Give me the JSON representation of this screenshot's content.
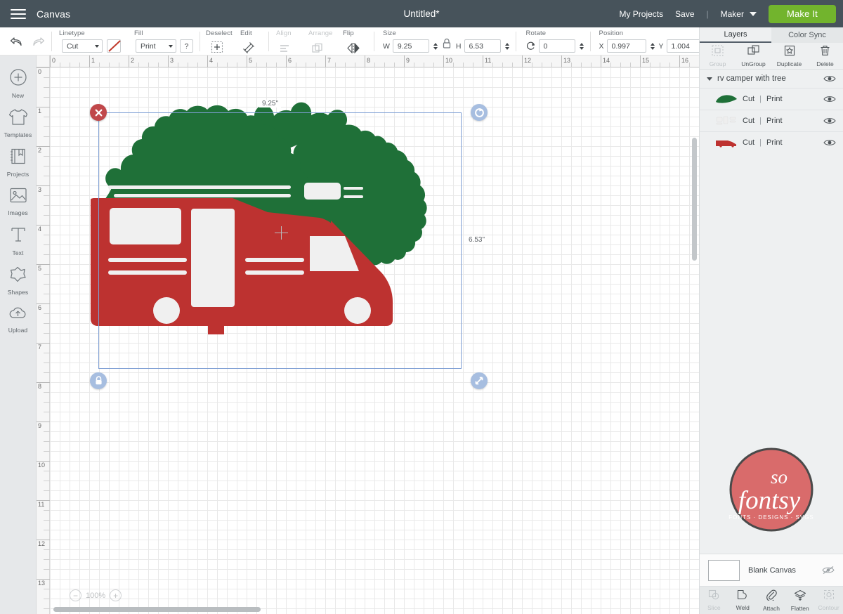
{
  "header": {
    "menu_icon": "hamburger-icon",
    "canvas_label": "Canvas",
    "document_title": "Untitled*",
    "my_projects": "My Projects",
    "save": "Save",
    "separator": "|",
    "machine": "Maker",
    "make_it": "Make It",
    "accent_green": "#72b42d",
    "header_bg": "#47535b"
  },
  "toolbar": {
    "undo_icon": "undo-arrow-icon",
    "redo_icon": "redo-arrow-icon",
    "linetype_label": "Linetype",
    "linetype_value": "Cut",
    "linetype_color_swatch": "#c0392b",
    "fill_label": "Fill",
    "fill_value": "Print",
    "fill_help": "?",
    "deselect_label": "Deselect",
    "edit_label": "Edit",
    "align_label": "Align",
    "arrange_label": "Arrange",
    "flip_label": "Flip",
    "size_label": "Size",
    "width_prefix": "W",
    "width_value": "9.25",
    "lock_icon": "lock-aspect-icon",
    "height_prefix": "H",
    "height_value": "6.53",
    "rotate_label": "Rotate",
    "rotate_value": "0",
    "position_label": "Position",
    "x_prefix": "X",
    "x_value": "0.997",
    "y_prefix": "Y",
    "y_value": "1.004",
    "highlight_color": "#e4515c"
  },
  "sidebar": {
    "items": [
      {
        "label": "New",
        "icon": "plus-circle-icon"
      },
      {
        "label": "Templates",
        "icon": "tshirt-icon"
      },
      {
        "label": "Projects",
        "icon": "book-icon"
      },
      {
        "label": "Images",
        "icon": "picture-icon"
      },
      {
        "label": "Text",
        "icon": "text-t-icon"
      },
      {
        "label": "Shapes",
        "icon": "shapes-icon"
      },
      {
        "label": "Upload",
        "icon": "cloud-upload-icon"
      }
    ]
  },
  "canvas": {
    "ruler_h_labels": [
      "0",
      "1",
      "2",
      "3",
      "4",
      "5",
      "6",
      "7",
      "8",
      "9",
      "10",
      "11",
      "12",
      "13",
      "14",
      "15",
      "16"
    ],
    "ruler_v_labels": [
      "0",
      "1",
      "2",
      "3",
      "4",
      "5",
      "6",
      "7",
      "8",
      "9",
      "10",
      "11",
      "12",
      "13"
    ],
    "width_dimension": "9.25\"",
    "height_dimension": "6.53\"",
    "zoom_level": "100%",
    "zoom_out_icon": "minus-circle-icon",
    "zoom_in_icon": "plus-circle-icon",
    "handles": {
      "delete": "delete-handle-icon",
      "rotate": "rotate-handle-icon",
      "lock": "lock-handle-icon",
      "resize": "resize-handle-icon"
    },
    "art_colors": {
      "camper_red": "#bd3230",
      "tree_green": "#1f7038",
      "window_white": "#f0f0f0"
    }
  },
  "right_panel": {
    "tabs": [
      {
        "label": "Layers",
        "active": true
      },
      {
        "label": "Color Sync",
        "active": false
      }
    ],
    "tools": [
      {
        "label": "Group",
        "icon": "group-icon",
        "disabled": true
      },
      {
        "label": "UnGroup",
        "icon": "ungroup-icon",
        "disabled": false
      },
      {
        "label": "Duplicate",
        "icon": "duplicate-icon",
        "disabled": false
      },
      {
        "label": "Delete",
        "icon": "trash-icon",
        "disabled": false
      }
    ],
    "group": {
      "name": "rv camper with tree",
      "expanded": true,
      "visibility_icon": "eye-icon"
    },
    "layers": [
      {
        "swatch": "tree-green-shape",
        "linetype": "Cut",
        "divider": "|",
        "fill": "Print",
        "visibility_icon": "eye-icon"
      },
      {
        "swatch": "windows-white-shape",
        "linetype": "Cut",
        "divider": "|",
        "fill": "Print",
        "visibility_icon": "eye-icon"
      },
      {
        "swatch": "camper-red-shape",
        "linetype": "Cut",
        "divider": "|",
        "fill": "Print",
        "visibility_icon": "eye-icon"
      }
    ],
    "logo": {
      "line1": "so",
      "line2": "fontsy",
      "tagline": "FONTS · DESIGNS · SVGS",
      "color": "#d96b6b"
    },
    "canvas_row": {
      "label": "Blank Canvas",
      "visibility_icon": "eye-off-icon"
    },
    "bottom_tools": [
      {
        "label": "Slice",
        "icon": "slice-icon",
        "disabled": true
      },
      {
        "label": "Weld",
        "icon": "weld-icon",
        "disabled": false
      },
      {
        "label": "Attach",
        "icon": "paperclip-icon",
        "disabled": false
      },
      {
        "label": "Flatten",
        "icon": "flatten-icon",
        "disabled": false
      },
      {
        "label": "Contour",
        "icon": "contour-icon",
        "disabled": true
      }
    ]
  }
}
